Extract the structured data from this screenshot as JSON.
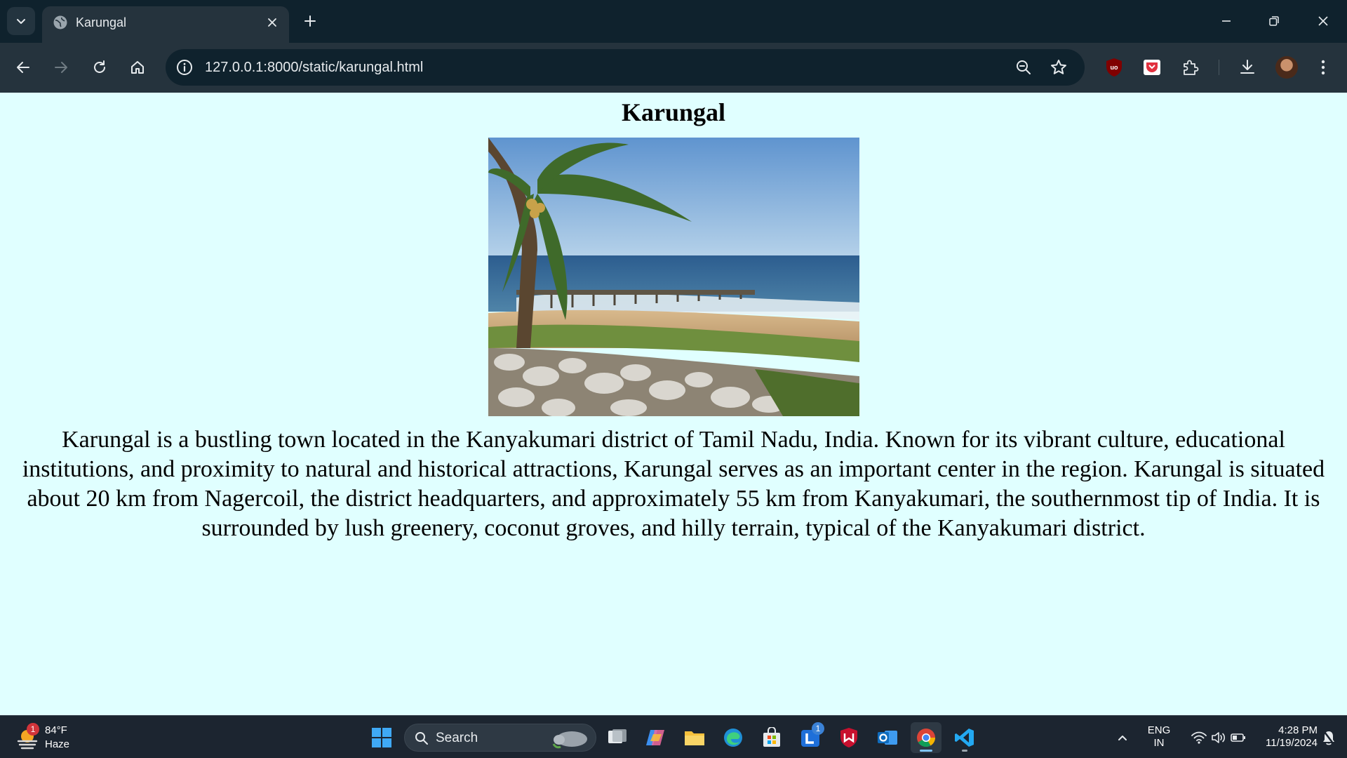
{
  "browser": {
    "tab": {
      "title": "Karungal"
    },
    "address_bar": {
      "url": "127.0.0.1:8000/static/karungal.html"
    }
  },
  "page": {
    "title": "Karungal",
    "image_alt": "Karungal beach with coconut palm and pier",
    "paragraph": "Karungal is a bustling town located in the Kanyakumari district of Tamil Nadu, India. Known for its vibrant culture, educational institutions, and proximity to natural and historical attractions, Karungal serves as an important center in the region. Karungal is situated about 20 km from Nagercoil, the district headquarters, and approximately 55 km from Kanyakumari, the southernmost tip of India. It is surrounded by lush greenery, coconut groves, and hilly terrain, typical of the Kanyakumari district."
  },
  "taskbar": {
    "weather": {
      "temp": "84°F",
      "condition": "Haze",
      "badge": "1"
    },
    "search_label": "Search",
    "lens_badge": "1",
    "tray": {
      "lang1": "ENG",
      "lang2": "IN",
      "time": "4:28 PM",
      "date": "11/19/2024"
    }
  },
  "colors": {
    "page_background": "#e0ffff",
    "titlebar": "#0f222d",
    "toolbar": "#25333d"
  }
}
